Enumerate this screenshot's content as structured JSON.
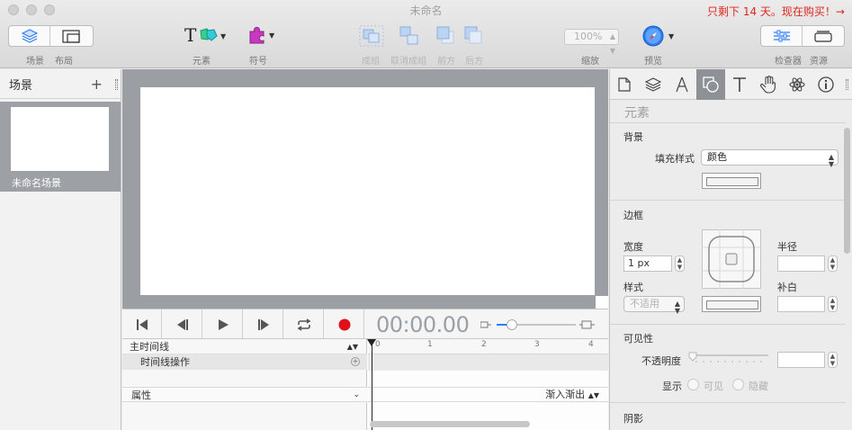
{
  "window": {
    "title": "未命名",
    "trial_text": "只剩下 14 天。现在购买！→"
  },
  "toolbar": {
    "scenes_label": "场景",
    "layout_label": "布局",
    "elements_label": "元素",
    "symbols_label": "符号",
    "group_label": "成组",
    "ungroup_label": "取消成组",
    "front_label": "前方",
    "back_label": "后方",
    "zoom_label": "缩放",
    "zoom_value": "100%",
    "preview_label": "预览",
    "inspector_label": "检查器",
    "library_label": "资源"
  },
  "scenes": {
    "header": "场景",
    "add_symbol": "+",
    "items": [
      {
        "label": "未命名场景"
      }
    ]
  },
  "transport": {
    "timecode": "00:00.00"
  },
  "timeline": {
    "main_timeline": "主时间线",
    "action_row": "时间线操作",
    "properties": "属性",
    "easing": "渐入渐出",
    "ruler": [
      "0",
      "1",
      "2",
      "3",
      "4"
    ]
  },
  "inspector": {
    "section_title": "元素",
    "background": {
      "title": "背景",
      "fill_style_label": "填充样式",
      "fill_style_value": "颜色"
    },
    "border": {
      "title": "边框",
      "width_label": "宽度",
      "width_value": "1 px",
      "style_label": "样式",
      "style_value": "不适用",
      "radius_label": "半径",
      "padding_label": "补白"
    },
    "visibility": {
      "title": "可见性",
      "opacity_label": "不透明度",
      "display_label": "显示",
      "visible_label": "可见",
      "hidden_label": "隐藏"
    },
    "shadow": {
      "title": "阴影"
    }
  },
  "colors": {
    "accent": "#2e7cf6",
    "record": "#e0101a",
    "trial": "#e0271d",
    "selected_scene": "#9da0a5",
    "canvas_bg": "#9b9ea3"
  }
}
